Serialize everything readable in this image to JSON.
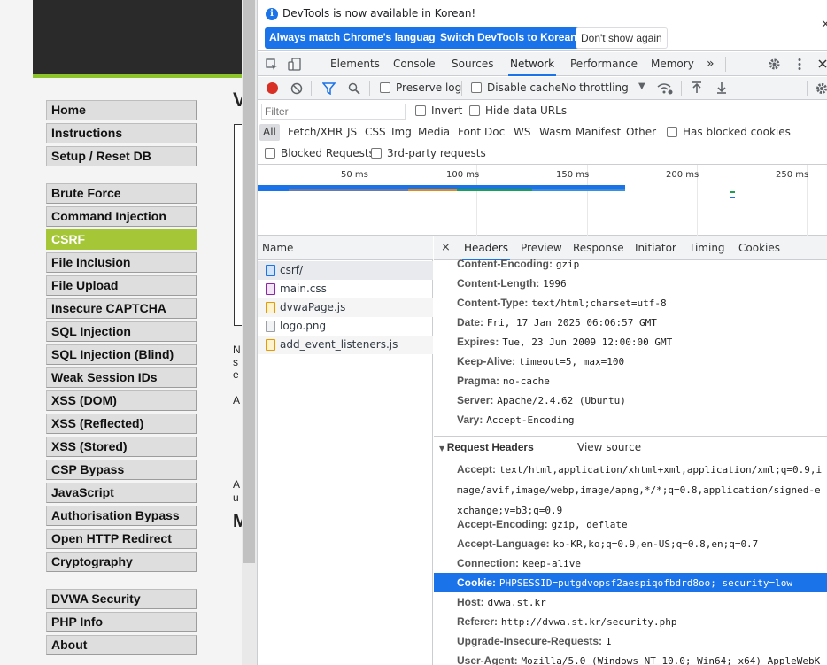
{
  "dvwa": {
    "menu_group1": [
      "Home",
      "Instructions",
      "Setup / Reset DB"
    ],
    "menu_group2": [
      "Brute Force",
      "Command Injection",
      "CSRF",
      "File Inclusion",
      "File Upload",
      "Insecure CAPTCHA",
      "SQL Injection",
      "SQL Injection (Blind)",
      "Weak Session IDs",
      "XSS (DOM)",
      "XSS (Reflected)",
      "XSS (Stored)",
      "CSP Bypass",
      "JavaScript",
      "Authorisation Bypass",
      "Open HTTP Redirect",
      "Cryptography"
    ],
    "menu_group3": [
      "DVWA Security",
      "PHP Info",
      "About"
    ],
    "active_item": "CSRF",
    "fragments": {
      "v": "V",
      "n": "N",
      "s": "s",
      "e": "e",
      "a1": "A",
      "a2": "A",
      "u": "u",
      "m": "M"
    }
  },
  "infobar": {
    "message": "DevTools is now available in Korean!",
    "btn_match": "Always match Chrome's language",
    "btn_switch": "Switch DevTools to Korean",
    "btn_dismiss": "Don't show again",
    "close": "×"
  },
  "tabs": [
    "Elements",
    "Console",
    "Sources",
    "Network",
    "Performance",
    "Memory"
  ],
  "active_tab": "Network",
  "more_tabs": "»",
  "toolbar": {
    "preserve_log": "Preserve log",
    "disable_cache": "Disable cache",
    "throttling": "No throttling"
  },
  "filter": {
    "placeholder": "Filter",
    "invert": "Invert",
    "hide_data_urls": "Hide data URLs",
    "types": [
      "All",
      "Fetch/XHR",
      "JS",
      "CSS",
      "Img",
      "Media",
      "Font",
      "Doc",
      "WS",
      "Wasm",
      "Manifest",
      "Other"
    ],
    "has_blocked_cookies": "Has blocked cookies",
    "blocked_requests": "Blocked Requests",
    "third_party": "3rd-party requests"
  },
  "overview": {
    "ticks": [
      "50 ms",
      "100 ms",
      "150 ms",
      "200 ms",
      "250 ms"
    ]
  },
  "requests": {
    "header": "Name",
    "items": [
      {
        "name": "csrf/",
        "icon": "doc-icon"
      },
      {
        "name": "main.css",
        "icon": "css-icon"
      },
      {
        "name": "dvwaPage.js",
        "icon": "js-icon"
      },
      {
        "name": "logo.png",
        "icon": "image-icon"
      },
      {
        "name": "add_event_listeners.js",
        "icon": "js-icon"
      }
    ]
  },
  "details": {
    "tabs": [
      "Headers",
      "Preview",
      "Response",
      "Initiator",
      "Timing",
      "Cookies"
    ],
    "active_tab": "Headers",
    "response_headers": [
      {
        "k": "Content-Encoding:",
        "v": "gzip"
      },
      {
        "k": "Content-Length:",
        "v": "1996"
      },
      {
        "k": "Content-Type:",
        "v": "text/html;charset=utf-8"
      },
      {
        "k": "Date:",
        "v": "Fri, 17 Jan 2025 06:06:57 GMT"
      },
      {
        "k": "Expires:",
        "v": "Tue, 23 Jun 2009 12:00:00 GMT"
      },
      {
        "k": "Keep-Alive:",
        "v": "timeout=5, max=100"
      },
      {
        "k": "Pragma:",
        "v": "no-cache"
      },
      {
        "k": "Server:",
        "v": "Apache/2.4.62 (Ubuntu)"
      },
      {
        "k": "Vary:",
        "v": "Accept-Encoding"
      }
    ],
    "request_section": "Request Headers",
    "view_source": "View source",
    "accept_key": "Accept:",
    "accept_lines": [
      "text/html,application/xhtml+xml,application/xml;q=0.9,i",
      "mage/avif,image/webp,image/apng,*/*;q=0.8,application/signed-e",
      "xchange;v=b3;q=0.9"
    ],
    "request_headers": [
      {
        "k": "Accept-Encoding:",
        "v": "gzip, deflate"
      },
      {
        "k": "Accept-Language:",
        "v": "ko-KR,ko;q=0.9,en-US;q=0.8,en;q=0.7"
      },
      {
        "k": "Connection:",
        "v": "keep-alive"
      },
      {
        "k": "Cookie:",
        "v": "PHPSESSID=putgdvopsf2aespiqofbdrd8oo; security=low"
      },
      {
        "k": "Host:",
        "v": "dvwa.st.kr"
      },
      {
        "k": "Referer:",
        "v": "http://dvwa.st.kr/security.php"
      },
      {
        "k": "Upgrade-Insecure-Requests:",
        "v": "1"
      },
      {
        "k": "User-Agent:",
        "v": "Mozilla/5.0 (Windows NT 10.0; Win64; x64) AppleWebK"
      }
    ]
  },
  "colors": {
    "accent": "#1a73e8",
    "dvwa_green": "#a5c737",
    "record": "#d93025"
  }
}
